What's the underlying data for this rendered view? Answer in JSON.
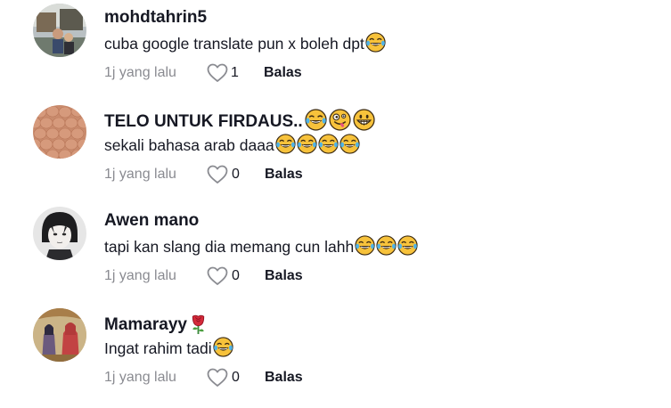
{
  "comments": [
    {
      "username": "mohdtahrin5",
      "username_emojis": [],
      "text": "cuba google translate pun x boleh dpt",
      "text_emojis": [
        "tears-of-joy"
      ],
      "time": "1j yang lalu",
      "likes": "1",
      "reply_label": "Balas"
    },
    {
      "username": "TELO UNTUK FIRDAUS..",
      "username_emojis": [
        "tears-of-joy",
        "zany-face",
        "grinning-face"
      ],
      "text": "sekali bahasa arab daaa",
      "text_emojis": [
        "tears-of-joy",
        "tears-of-joy",
        "tears-of-joy",
        "tears-of-joy"
      ],
      "time": "1j yang lalu",
      "likes": "0",
      "reply_label": "Balas"
    },
    {
      "username": "Awen mano",
      "username_emojis": [],
      "text": "tapi kan slang dia memang cun lahh",
      "text_emojis": [
        "tears-of-joy",
        "tears-of-joy",
        "tears-of-joy"
      ],
      "time": "1j yang lalu",
      "likes": "0",
      "reply_label": "Balas"
    },
    {
      "username": "Mamarayy",
      "username_emojis": [
        "rose"
      ],
      "text": "Ingat rahim tadi",
      "text_emojis": [
        "tears-of-joy"
      ],
      "time": "1j yang lalu",
      "likes": "0",
      "reply_label": "Balas"
    }
  ],
  "colors": {
    "text": "#161823",
    "muted": "#8a8b91"
  },
  "icons": {
    "like": "heart-outline-icon",
    "emoji_tears": "tears-of-joy-emoji",
    "emoji_zany": "zany-face-emoji",
    "emoji_grin": "grinning-face-emoji",
    "emoji_rose": "rose-emoji"
  }
}
